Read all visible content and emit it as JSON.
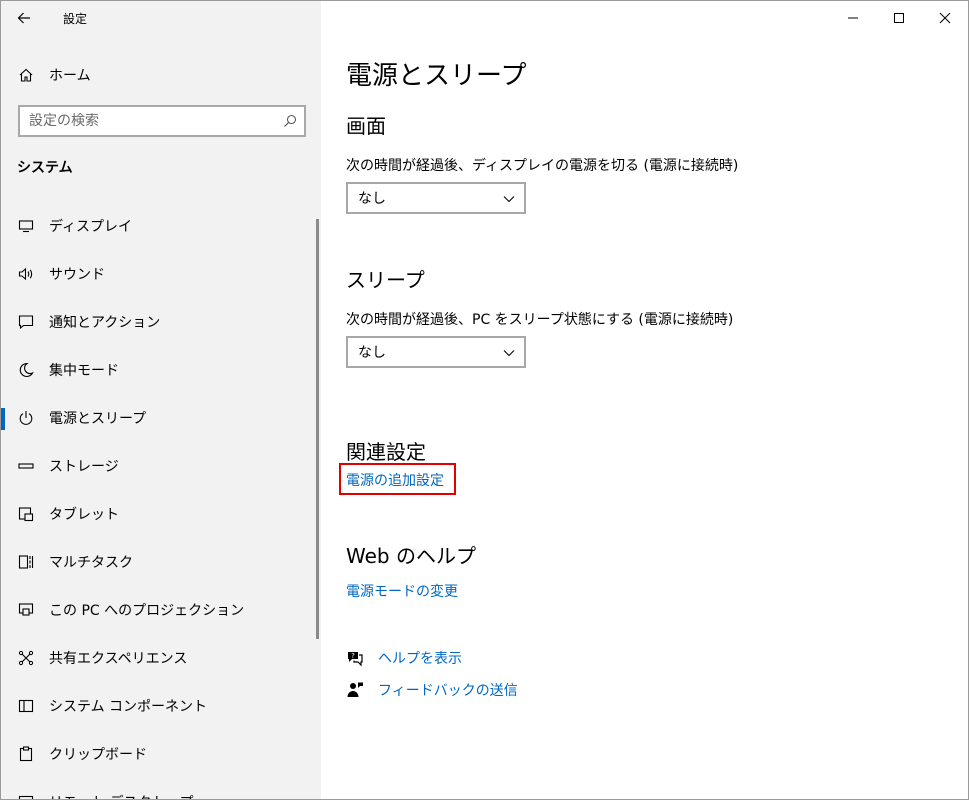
{
  "window": {
    "title": "設定"
  },
  "sidebar": {
    "home_label": "ホーム",
    "search_placeholder": "設定の検索",
    "section_label": "システム",
    "items": [
      {
        "label": "ディスプレイ",
        "icon": "display-icon"
      },
      {
        "label": "サウンド",
        "icon": "speaker-icon"
      },
      {
        "label": "通知とアクション",
        "icon": "message-icon"
      },
      {
        "label": "集中モード",
        "icon": "moon-icon"
      },
      {
        "label": "電源とスリープ",
        "icon": "power-icon",
        "active": true
      },
      {
        "label": "ストレージ",
        "icon": "storage-icon"
      },
      {
        "label": "タブレット",
        "icon": "tablet-icon"
      },
      {
        "label": "マルチタスク",
        "icon": "multitask-icon"
      },
      {
        "label": "この PC へのプロジェクション",
        "icon": "projection-icon"
      },
      {
        "label": "共有エクスペリエンス",
        "icon": "share-icon"
      },
      {
        "label": "システム コンポーネント",
        "icon": "components-icon"
      },
      {
        "label": "クリップボード",
        "icon": "clipboard-icon"
      },
      {
        "label": "リモート デスクトップ",
        "icon": "remote-icon"
      }
    ]
  },
  "main": {
    "title": "電源とスリープ",
    "screen": {
      "heading": "画面",
      "description": "次の時間が経過後、ディスプレイの電源を切る (電源に接続時)",
      "value": "なし"
    },
    "sleep": {
      "heading": "スリープ",
      "description": "次の時間が経過後、PC をスリープ状態にする (電源に接続時)",
      "value": "なし"
    },
    "related": {
      "heading": "関連設定",
      "link": "電源の追加設定"
    },
    "web_help": {
      "heading": "Web のヘルプ",
      "link": "電源モードの変更"
    },
    "help_links": {
      "get_help": "ヘルプを表示",
      "feedback": "フィードバックの送信"
    }
  },
  "colors": {
    "accent": "#0067c0",
    "highlight": "#e00000",
    "sidebar_bg": "#f2f2f2"
  }
}
